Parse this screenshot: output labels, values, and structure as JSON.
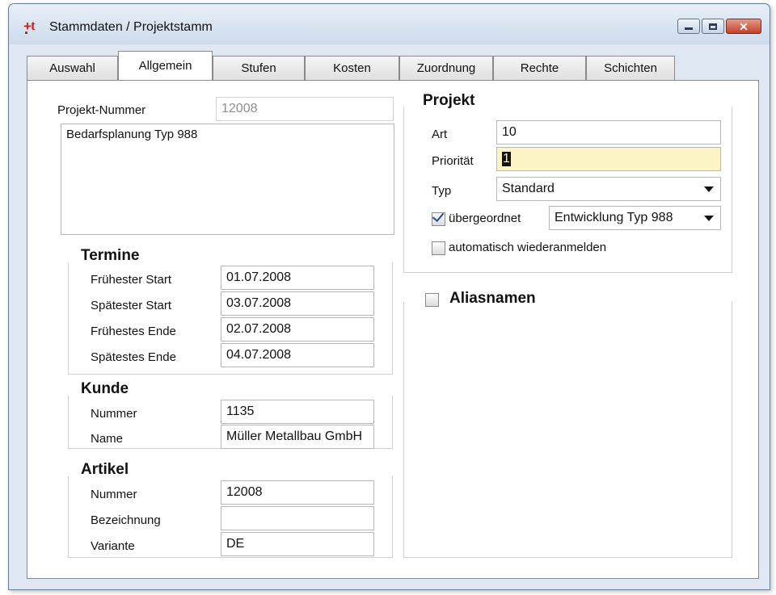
{
  "window": {
    "title": "Stammdaten / Projektstamm"
  },
  "tabs": [
    "Auswahl",
    "Allgemein",
    "Stufen",
    "Kosten",
    "Zuordnung",
    "Rechte",
    "Schichten"
  ],
  "active_tab": "Allgemein",
  "projekt_nummer": {
    "label": "Projekt-Nummer",
    "value": "12008"
  },
  "description": "Bedarfsplanung Typ 988",
  "termine": {
    "title": "Termine",
    "rows": [
      {
        "label": "Frühester Start",
        "value": "01.07.2008"
      },
      {
        "label": "Spätester Start",
        "value": "03.07.2008"
      },
      {
        "label": "Frühestes Ende",
        "value": "02.07.2008"
      },
      {
        "label": "Spätestes Ende",
        "value": "04.07.2008"
      }
    ]
  },
  "kunde": {
    "title": "Kunde",
    "nummer_label": "Nummer",
    "nummer": "1135",
    "name_label": "Name",
    "name": "Müller Metallbau GmbH"
  },
  "artikel": {
    "title": "Artikel",
    "nummer_label": "Nummer",
    "nummer": "12008",
    "bezeichnung_label": "Bezeichnung",
    "bezeichnung": "",
    "variante_label": "Variante",
    "variante": "DE"
  },
  "projekt": {
    "title": "Projekt",
    "art_label": "Art",
    "art": "10",
    "prioritaet_label": "Priorität",
    "prioritaet": "1",
    "typ_label": "Typ",
    "typ": "Standard",
    "uebergeordnet_label": "übergeordnet",
    "uebergeordnet_checked": true,
    "uebergeordnet_value": "Entwicklung Typ 988",
    "auto_label": "automatisch wiederanmelden",
    "auto_checked": false
  },
  "aliasnamen": {
    "title": "Aliasnamen",
    "checked": false
  },
  "colors": {
    "field_highlight": "#fcf4c4",
    "close_button": "#c2412a",
    "title_bar": "#dfe8f2"
  }
}
